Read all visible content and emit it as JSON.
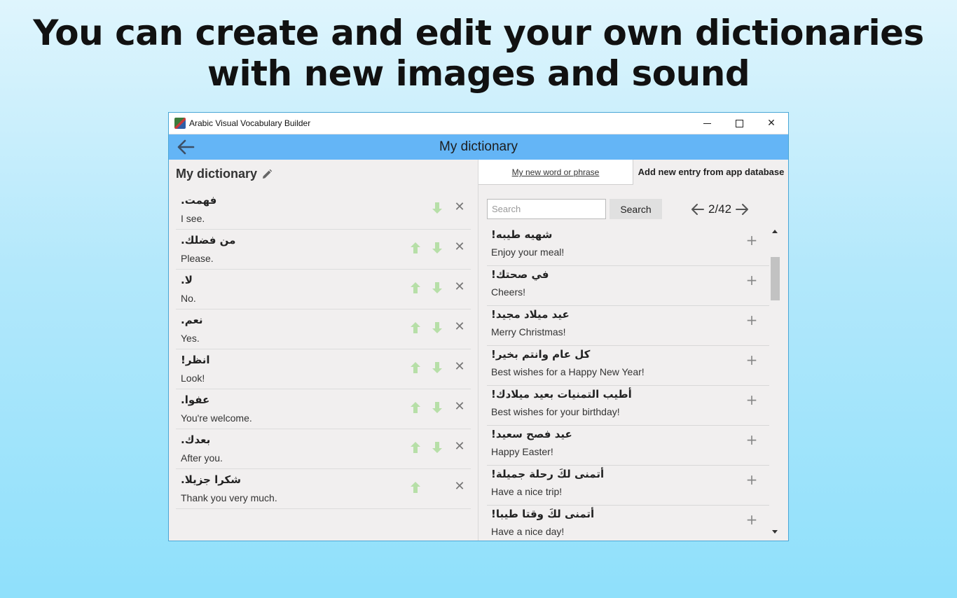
{
  "headline": {
    "line1": "You can create and edit your own dictionaries",
    "line2": "with new images and sound"
  },
  "window": {
    "title": "Arabic Visual Vocabulary Builder",
    "controls": {
      "minimize": "",
      "maximize": "",
      "close": "✕"
    }
  },
  "appbar": {
    "title": "My dictionary"
  },
  "left": {
    "heading": "My dictionary",
    "delete_glyph": "✕",
    "entries": [
      {
        "ar": "فهمت.",
        "en": "I see.",
        "has_up": false,
        "has_down": true
      },
      {
        "ar": "من فضلك.",
        "en": "Please.",
        "has_up": true,
        "has_down": true
      },
      {
        "ar": "لا.",
        "en": "No.",
        "has_up": true,
        "has_down": true
      },
      {
        "ar": "نعم.",
        "en": "Yes.",
        "has_up": true,
        "has_down": true
      },
      {
        "ar": "انظر!",
        "en": "Look!",
        "has_up": true,
        "has_down": true
      },
      {
        "ar": "عفوا.",
        "en": "You're welcome.",
        "has_up": true,
        "has_down": true
      },
      {
        "ar": "بعدك.",
        "en": "After you.",
        "has_up": true,
        "has_down": true
      },
      {
        "ar": "شكرا جزيلا.",
        "en": "Thank you very much.",
        "has_up": true,
        "has_down": false
      }
    ]
  },
  "right": {
    "tabs": {
      "new_word": "My new word or phrase",
      "from_db": "Add new entry from app database"
    },
    "search": {
      "placeholder": "Search",
      "button": "Search"
    },
    "pager": {
      "text": "2/42"
    },
    "add_glyph": "+",
    "entries": [
      {
        "ar": "شهيه طيبه!",
        "en": "Enjoy your meal!"
      },
      {
        "ar": "في صحتك!",
        "en": "Cheers!"
      },
      {
        "ar": "عيد ميلاد مجيد!",
        "en": "Merry Christmas!"
      },
      {
        "ar": "كل عام وانتم بخير!",
        "en": "Best wishes for a Happy New Year!"
      },
      {
        "ar": "أطيب التمنيات بعيد ميلادك!",
        "en": "Best wishes for your birthday!"
      },
      {
        "ar": "عيد فصح سعيد!",
        "en": "Happy Easter!"
      },
      {
        "ar": "أتمنى لكَ رحلة جميلة!",
        "en": "Have a nice trip!"
      },
      {
        "ar": "أتمنى لكَ وقتا طيبا!",
        "en": "Have a nice day!"
      }
    ]
  },
  "colors": {
    "appbar": "#64b5f6",
    "arrow_green": "#b7dfa8",
    "border_blue": "#4aa6d6"
  }
}
